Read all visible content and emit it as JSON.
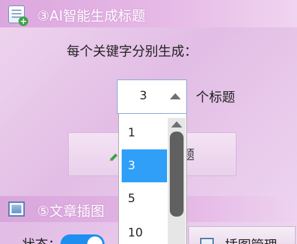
{
  "section_ai": {
    "title": "③AI智能生成标题",
    "keyword_text": "每个关键字分别生成：",
    "count_select": {
      "value": "3",
      "suffix": "个标题",
      "options": [
        "1",
        "3",
        "5",
        "10"
      ],
      "selected_index": 1
    },
    "generate_button_tail": "题"
  },
  "section_images": {
    "title": "⑤文章插图",
    "status_label": "状态：",
    "toggle_on": true,
    "manage_button": "插图管理"
  },
  "colors": {
    "accent": "#2f9ff8",
    "toggle": "#1e8ef0",
    "header_bg": "#dca7de"
  }
}
